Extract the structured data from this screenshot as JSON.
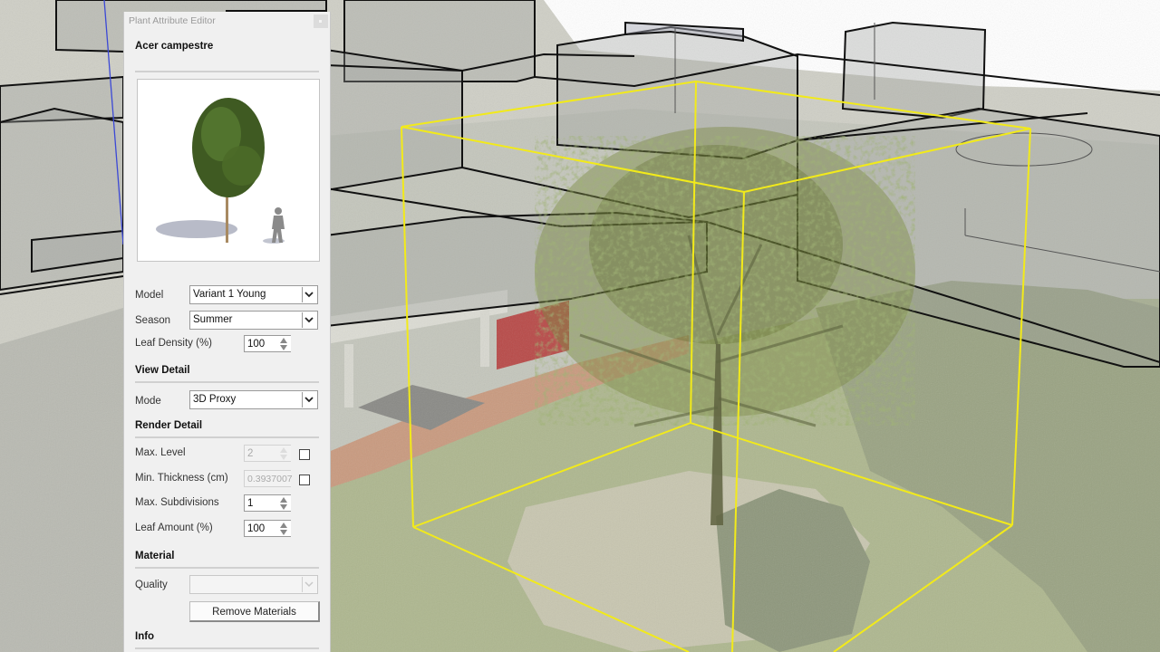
{
  "viewport": {
    "description": "3D viewport with translucent massing blocks over a colored point cloud of a garden, a tree model, and a yellow bounding box",
    "colors": {
      "selection_box": "#f2ea1a",
      "block_edge": "#111111",
      "block_fill": "#9a9e9a",
      "axis_blue": "#3b48d6",
      "ground_grass": "#a8b48a",
      "patio": "#c9987c"
    }
  },
  "panel": {
    "window_title": "Plant Attribute Editor",
    "plant_name": "Acer campestre",
    "preview_alt": "tree-with-human-scale-figure",
    "model": {
      "label": "Model",
      "value": "Variant 1 Young"
    },
    "season": {
      "label": "Season",
      "value": "Summer"
    },
    "leaf_density": {
      "label": "Leaf Density (%)",
      "value": "100"
    },
    "view_detail": {
      "heading": "View Detail",
      "mode": {
        "label": "Mode",
        "value": "3D Proxy"
      }
    },
    "render_detail": {
      "heading": "Render Detail",
      "max_level": {
        "label": "Max. Level",
        "value": "2",
        "enabled": false,
        "checked": false
      },
      "min_thickness": {
        "label": "Min. Thickness (cm)",
        "value": "0.3937007",
        "enabled": false,
        "checked": false
      },
      "max_subdivisions": {
        "label": "Max. Subdivisions",
        "value": "1"
      },
      "leaf_amount": {
        "label": "Leaf Amount (%)",
        "value": "100"
      }
    },
    "material": {
      "heading": "Material",
      "quality": {
        "label": "Quality",
        "value": "",
        "enabled": false
      },
      "remove_button": "Remove Materials"
    },
    "info": {
      "heading": "Info"
    }
  }
}
